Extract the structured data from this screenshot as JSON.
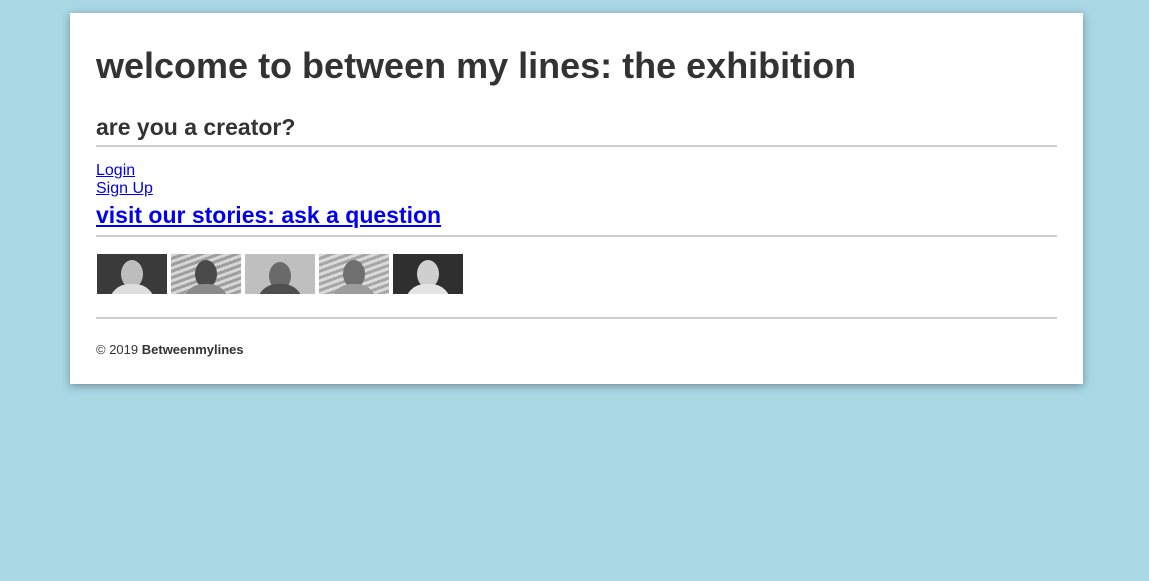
{
  "page": {
    "title": "welcome to between my lines: the exhibition",
    "creator_heading": "are you a creator?",
    "login_label": "Login",
    "signup_label": "Sign Up",
    "stories_link": "visit our stories: ask a question",
    "footer_prefix": "© 2019",
    "footer_brand": "Betweenmylines"
  },
  "colors": {
    "background": "#a9d7e4",
    "text": "#333333",
    "link": "#0000ee"
  },
  "thumbnails": [
    {
      "name": "person-photo-1"
    },
    {
      "name": "person-photo-2"
    },
    {
      "name": "person-photo-3"
    },
    {
      "name": "person-photo-4"
    },
    {
      "name": "person-photo-5"
    }
  ]
}
